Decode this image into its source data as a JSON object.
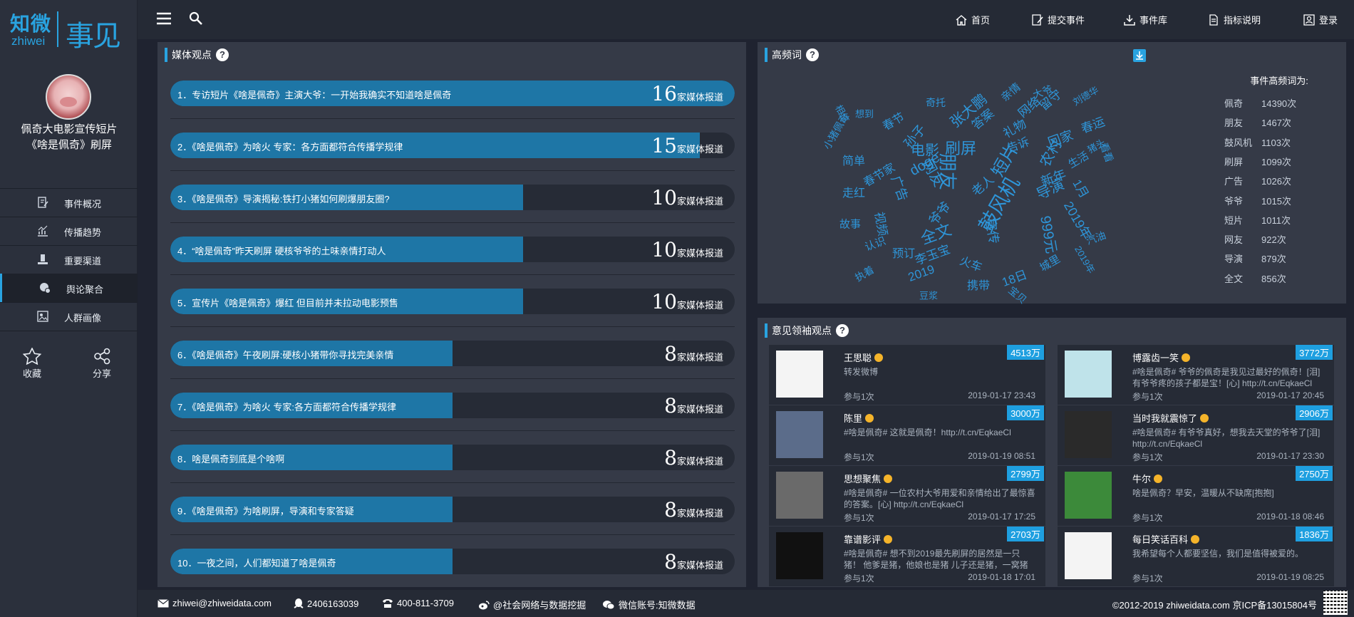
{
  "brand": {
    "logo_cn": "知微",
    "logo_en": "zhiwei",
    "logo_sub": "事见"
  },
  "event": {
    "title": "佩奇大电影宣传短片《啥是佩奇》刷屏"
  },
  "sidebar": {
    "items": [
      {
        "label": "事件概况",
        "icon": "document-edit-icon"
      },
      {
        "label": "传播趋势",
        "icon": "trend-chart-icon"
      },
      {
        "label": "重要渠道",
        "icon": "podium-icon"
      },
      {
        "label": "舆论聚合",
        "icon": "opinion-chat-icon",
        "active": true
      },
      {
        "label": "人群画像",
        "icon": "portrait-icon"
      }
    ],
    "collect_label": "收藏",
    "share_label": "分享"
  },
  "topnav": {
    "home": "首页",
    "submit": "提交事件",
    "library": "事件库",
    "guide": "指标说明",
    "login": "登录"
  },
  "media": {
    "title": "媒体观点",
    "suffix": "家媒体报道",
    "max": 16,
    "items": [
      {
        "label": "1．专访短片《啥是佩奇》主演大爷：一开始我确实不知道啥是佩奇",
        "count": 16
      },
      {
        "label": "2．《啥是佩奇》为啥火 专家：各方面都符合传播学规律",
        "count": 15
      },
      {
        "label": "3．《啥是佩奇》导演揭秘:铁打小猪如何刷爆朋友圈?",
        "count": 10
      },
      {
        "label": "4．“啥是佩奇”昨天刷屏 硬核爷爷的土味亲情打动人",
        "count": 10
      },
      {
        "label": "5．宣传片《啥是佩奇》爆红 但目前并未拉动电影预售",
        "count": 10
      },
      {
        "label": "6．《啥是佩奇》午夜刷屏:硬核小猪带你寻找完美亲情",
        "count": 8
      },
      {
        "label": "7．《啥是佩奇》为啥火 专家:各方面都符合传播学规律",
        "count": 8
      },
      {
        "label": "8．啥是佩奇到底是个啥啊",
        "count": 8
      },
      {
        "label": "9．《啥是佩奇》为啥刷屏，导演和专家答疑",
        "count": 8
      },
      {
        "label": "10．一夜之间，人们都知道了啥是佩奇",
        "count": 8
      }
    ]
  },
  "wordcloud": {
    "title": "高频词",
    "head": "事件高频词为:",
    "top": [
      {
        "word": "佩奇",
        "count": "14390次"
      },
      {
        "word": "朋友",
        "count": "1467次"
      },
      {
        "word": "鼓风机",
        "count": "1103次"
      },
      {
        "word": "刷屏",
        "count": "1099次"
      },
      {
        "word": "广告",
        "count": "1026次"
      },
      {
        "word": "爷爷",
        "count": "1015次"
      },
      {
        "word": "短片",
        "count": "1011次"
      },
      {
        "word": "网友",
        "count": "922次"
      },
      {
        "word": "导演",
        "count": "879次"
      },
      {
        "word": "全文",
        "count": "856次"
      }
    ],
    "cloud_words": [
      {
        "t": "朋友",
        "s": 26,
        "r": 90
      },
      {
        "t": "鼓风机",
        "s": 28,
        "r": -60
      },
      {
        "t": "刷屏",
        "s": 22,
        "r": 0
      },
      {
        "t": "全文",
        "s": 22,
        "r": -20
      },
      {
        "t": "短片",
        "s": 24,
        "r": -60
      },
      {
        "t": "导演",
        "s": 20,
        "r": -25
      },
      {
        "t": "网友",
        "s": 20,
        "r": 60
      },
      {
        "t": "广告",
        "s": 18,
        "r": 70
      },
      {
        "t": "爷爷",
        "s": 18,
        "r": -50
      },
      {
        "t": "宣传",
        "s": 18,
        "r": 80
      },
      {
        "t": "电影",
        "s": 20,
        "r": 0
      },
      {
        "t": "2019年",
        "s": 18,
        "r": 60
      },
      {
        "t": "999元",
        "s": 20,
        "r": 80
      },
      {
        "t": "农村",
        "s": 20,
        "r": -60
      },
      {
        "t": "张大鹏",
        "s": 20,
        "r": -40
      },
      {
        "t": "回家",
        "s": 18,
        "r": -20
      },
      {
        "t": "春运",
        "s": 17,
        "r": -20
      },
      {
        "t": "礼物",
        "s": 17,
        "r": -30
      },
      {
        "t": "答案",
        "s": 17,
        "r": -40
      },
      {
        "t": "网络",
        "s": 17,
        "r": -40
      },
      {
        "t": "春节",
        "s": 16,
        "r": -30
      },
      {
        "t": "孙子",
        "s": 18,
        "r": -50
      },
      {
        "t": "doge",
        "s": 20,
        "r": -30
      },
      {
        "t": "留守",
        "s": 17,
        "r": -40
      },
      {
        "t": "告诉",
        "s": 16,
        "r": -20
      },
      {
        "t": "新年",
        "s": 18,
        "r": -20
      },
      {
        "t": "1月",
        "s": 17,
        "r": 60
      },
      {
        "t": "老人",
        "s": 17,
        "r": -40
      },
      {
        "t": "李玉宝",
        "s": 17,
        "r": -20
      },
      {
        "t": "预订",
        "s": 16,
        "r": 0
      },
      {
        "t": "火车",
        "s": 16,
        "r": 20
      },
      {
        "t": "携带",
        "s": 16,
        "r": 0
      },
      {
        "t": "18日",
        "s": 17,
        "r": -20
      },
      {
        "t": "宝贝",
        "s": 14,
        "r": 40
      },
      {
        "t": "城里",
        "s": 15,
        "r": -30
      },
      {
        "t": "视频",
        "s": 17,
        "r": 80
      },
      {
        "t": "简单",
        "s": 16,
        "r": 0
      },
      {
        "t": "走红",
        "s": 16,
        "r": 0
      },
      {
        "t": "故事",
        "s": 15,
        "r": 0
      },
      {
        "t": "认识",
        "s": 15,
        "r": -20
      },
      {
        "t": "小猪佩奇",
        "s": 14,
        "r": -60
      },
      {
        "t": "执着",
        "s": 14,
        "r": -30
      },
      {
        "t": "2019",
        "s": 17,
        "r": -20
      },
      {
        "t": "刘德华",
        "s": 13,
        "r": -30
      },
      {
        "t": "豆浆",
        "s": 13,
        "r": 0
      },
      {
        "t": "汽油",
        "s": 14,
        "r": -20
      },
      {
        "t": "生活",
        "s": 15,
        "r": -30
      },
      {
        "t": "大爷",
        "s": 14,
        "r": -20
      },
      {
        "t": "亲情",
        "s": 15,
        "r": -40
      },
      {
        "t": "看看",
        "s": 14,
        "r": 70
      },
      {
        "t": "猪头",
        "s": 13,
        "r": -30
      },
      {
        "t": "相信",
        "s": 13,
        "r": 60
      },
      {
        "t": "想到",
        "s": 13,
        "r": 0
      },
      {
        "t": "奇托",
        "s": 14,
        "r": 0
      },
      {
        "t": "春节家",
        "s": 16,
        "r": -30
      },
      {
        "t": "2019年",
        "s": 13,
        "r": 60
      }
    ]
  },
  "kol": {
    "title": "意见领袖观点",
    "items": [
      {
        "name": "王思聪",
        "fans": "4513万",
        "text": "转发微博",
        "count": "参与1次",
        "time": "2019-01-17 23:43"
      },
      {
        "name": "博露齿一笑",
        "fans": "3772万",
        "text": "#啥是佩奇# 爷爷的佩奇是我见过最好的佩奇！[泪]有爷爷疼的孩子都是宝！[心] http://t.cn/EqkaeCl",
        "count": "参与1次",
        "time": "2019-01-17 20:45"
      },
      {
        "name": "陈里",
        "fans": "3000万",
        "text": "#啥是佩奇# 这就是佩奇！http://t.cn/EqkaeCl",
        "count": "参与1次",
        "time": "2019-01-19 08:51"
      },
      {
        "name": "当时我就震惊了",
        "fans": "2906万",
        "text": "#啥是佩奇# 有爷爷真好，想我去天堂的爷爷了[泪] http://t.cn/EqkaeCl",
        "count": "参与1次",
        "time": "2019-01-17 23:30"
      },
      {
        "name": "思想聚焦",
        "fans": "2799万",
        "text": "#啥是佩奇# 一位农村大爷用爱和亲情给出了最惊喜的答案。[心] http://t.cn/EqkaeCl",
        "count": "参与1次",
        "time": "2019-01-17 17:25"
      },
      {
        "name": "牛尔",
        "fans": "2750万",
        "text": "啥是佩奇？早安，温暖从不缺席[抱抱]",
        "count": "参与1次",
        "time": "2019-01-18 08:46"
      },
      {
        "name": "靠谱影评",
        "fans": "2703万",
        "text": "#啥是佩奇# 想不到2019最先刷屏的居然是一只猪！ 他爹是猪，他娘也是猪 儿子还是猪，一窝猪",
        "count": "参与1次",
        "time": "2019-01-18 17:01"
      },
      {
        "name": "每日笑话百科",
        "fans": "1836万",
        "text": "我希望每个人都要坚信，我们是值得被爱的。",
        "count": "参与1次",
        "time": "2019-01-19 08:25"
      }
    ]
  },
  "footer": {
    "email": "zhiwei@zhiweidata.com",
    "qq": "2406163039",
    "phone": "400-811-3709",
    "weibo": "@社会网络与数据挖掘",
    "wechat": "微信账号:知微数据",
    "copyright": "©2012-2019 zhiweidata.com 京ICP备13015804号"
  },
  "colors": {
    "accent": "#29a3e0",
    "bar_fill": "#1e76a6",
    "panel": "#353a47",
    "bg": "#1f2330"
  }
}
